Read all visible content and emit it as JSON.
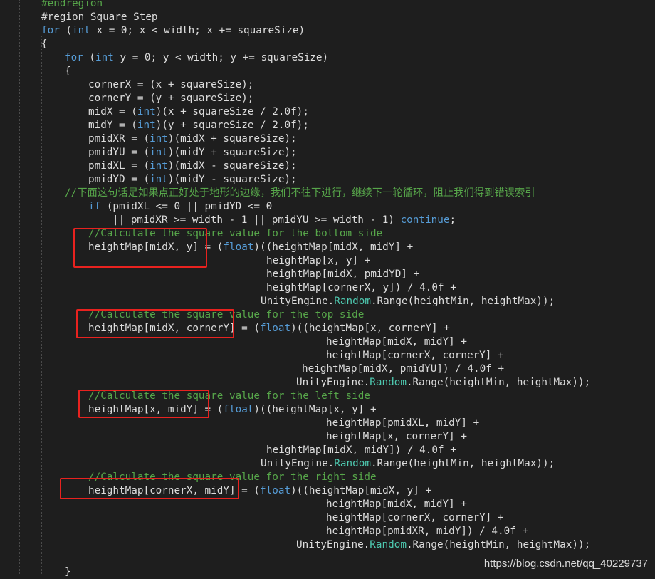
{
  "editor": {
    "colors": {
      "background": "#1e1e1e",
      "keyword": "#569cd6",
      "comment": "#57a64a",
      "type": "#4ec9b0",
      "plain": "#dcdcdc",
      "highlight_box": "#e8221f"
    },
    "lines": [
      [
        [
          "c",
          "#endregion"
        ]
      ],
      [
        [
          "p",
          "#region Square Step"
        ]
      ],
      [
        [
          "k",
          "for"
        ],
        [
          "p",
          " ("
        ],
        [
          "k",
          "int"
        ],
        [
          "p",
          " x = 0; x < width; x += squareSize)"
        ]
      ],
      [
        [
          "p",
          "{"
        ]
      ],
      [
        [
          "k",
          "for"
        ],
        [
          "p",
          " ("
        ],
        [
          "k",
          "int"
        ],
        [
          "p",
          " y = 0; y < width; y += squareSize)"
        ]
      ],
      [
        [
          "p",
          "{"
        ]
      ],
      [
        [
          "p",
          "cornerX = (x + squareSize);"
        ]
      ],
      [
        [
          "p",
          "cornerY = (y + squareSize);"
        ]
      ],
      [
        [
          "p",
          "midX = ("
        ],
        [
          "k",
          "int"
        ],
        [
          "p",
          ")(x + squareSize / 2.0f);"
        ]
      ],
      [
        [
          "p",
          "midY = ("
        ],
        [
          "k",
          "int"
        ],
        [
          "p",
          ")(y + squareSize / 2.0f);"
        ]
      ],
      [
        [
          "p",
          "pmidXR = ("
        ],
        [
          "k",
          "int"
        ],
        [
          "p",
          ")(midX + squareSize);"
        ]
      ],
      [
        [
          "p",
          "pmidYU = ("
        ],
        [
          "k",
          "int"
        ],
        [
          "p",
          ")(midY + squareSize);"
        ]
      ],
      [
        [
          "p",
          "pmidXL = ("
        ],
        [
          "k",
          "int"
        ],
        [
          "p",
          ")(midX - squareSize);"
        ]
      ],
      [
        [
          "p",
          "pmidYD = ("
        ],
        [
          "k",
          "int"
        ],
        [
          "p",
          ")(midY - squareSize);"
        ]
      ],
      [
        [
          "c",
          "//下面这句话是如果点正好处于地形的边缘，我们不往下进行，继续下一轮循环，阻止我们得到错误索引"
        ]
      ],
      [
        [
          "k",
          "if"
        ],
        [
          "p",
          " (pmidXL <= 0 || pmidYD <= 0"
        ]
      ],
      [
        [
          "p",
          "|| pmidXR >= width - 1 || pmidYU >= width - 1) "
        ],
        [
          "k",
          "continue"
        ],
        [
          "p",
          ";"
        ]
      ],
      [
        [
          "c",
          "//Calculate the square value for the bottom side"
        ]
      ],
      [
        [
          "p",
          "heightMap[midX, y] = ("
        ],
        [
          "k",
          "float"
        ],
        [
          "p",
          ")((heightMap[midX, midY] +"
        ]
      ],
      [
        [
          "p",
          "heightMap[x, y] +"
        ]
      ],
      [
        [
          "p",
          "heightMap[midX, pmidYD] +"
        ]
      ],
      [
        [
          "p",
          "heightMap[cornerX, y]) / 4.0f +"
        ]
      ],
      [
        [
          "p",
          "UnityEngine."
        ],
        [
          "t",
          "Random"
        ],
        [
          "p",
          ".Range(heightMin, heightMax));"
        ]
      ],
      [
        [
          "c",
          "//Calculate the square value for the top side"
        ]
      ],
      [
        [
          "p",
          "heightMap[midX, cornerY] = ("
        ],
        [
          "k",
          "float"
        ],
        [
          "p",
          ")((heightMap[x, cornerY] +"
        ]
      ],
      [
        [
          "p",
          "heightMap[midX, midY] +"
        ]
      ],
      [
        [
          "p",
          "heightMap[cornerX, cornerY] +"
        ]
      ],
      [
        [
          "p",
          "heightMap[midX, pmidYU]) / 4.0f +"
        ]
      ],
      [
        [
          "p",
          "UnityEngine."
        ],
        [
          "t",
          "Random"
        ],
        [
          "p",
          ".Range(heightMin, heightMax));"
        ]
      ],
      [
        [
          "c",
          "//Calculate the square value for the left side"
        ]
      ],
      [
        [
          "p",
          "heightMap[x, midY] = ("
        ],
        [
          "k",
          "float"
        ],
        [
          "p",
          ")((heightMap[x, y] +"
        ]
      ],
      [
        [
          "p",
          "heightMap[pmidXL, midY] +"
        ]
      ],
      [
        [
          "p",
          "heightMap[x, cornerY] +"
        ]
      ],
      [
        [
          "p",
          "heightMap[midX, midY]) / 4.0f +"
        ]
      ],
      [
        [
          "p",
          "UnityEngine."
        ],
        [
          "t",
          "Random"
        ],
        [
          "p",
          ".Range(heightMin, heightMax));"
        ]
      ],
      [
        [
          "c",
          "//Calculate the square value for the right side"
        ]
      ],
      [
        [
          "p",
          "heightMap[cornerX, midY] = ("
        ],
        [
          "k",
          "float"
        ],
        [
          "p",
          ")((heightMap[midX, y] +"
        ]
      ],
      [
        [
          "p",
          "heightMap[midX, midY] +"
        ]
      ],
      [
        [
          "p",
          "heightMap[cornerX, cornerY] +"
        ]
      ],
      [
        [
          "p",
          "heightMap[pmidXR, midY]) / 4.0f +"
        ]
      ],
      [
        [
          "p",
          "UnityEngine."
        ],
        [
          "t",
          "Random"
        ],
        [
          "p",
          ".Range(heightMin, heightMax));"
        ]
      ],
      [
        [
          "p",
          ""
        ]
      ],
      [
        [
          "p",
          "}"
        ]
      ]
    ]
  },
  "watermark": "https://blog.csdn.net/qq_40229737"
}
